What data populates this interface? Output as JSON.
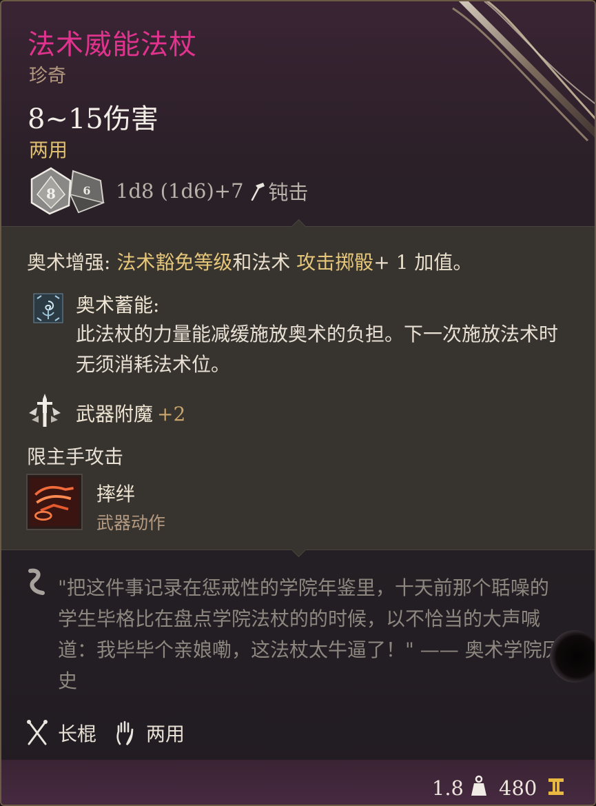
{
  "item": {
    "name": "法术威能法杖",
    "rarity": "珍奇",
    "damage": "8~15伤害",
    "handedness": "两用",
    "dice_text": "1d8 (1d6)+7",
    "damage_type": "钝击",
    "dice_faces": [
      "8",
      "6"
    ]
  },
  "boost": {
    "prefix": "奥术增强: ",
    "highlight1": "法术豁免等级",
    "mid": "和法术 ",
    "highlight2": "攻击掷骰",
    "suffix": "+ 1 加值。"
  },
  "passive": {
    "title": "奥术蓄能:",
    "description": "此法杖的力量能减缓施放奥术的负担。下一次施放法术时无须消耗法术位。"
  },
  "enchantment": {
    "label": "武器附魔",
    "value": "+2"
  },
  "restriction": "限主手攻击",
  "weapon_action": {
    "name": "摔绊",
    "type": "武器动作"
  },
  "flavor": "\"把这件事记录在惩戒性的学院年鉴里，十天前那个聒噪的学生毕格比在盘点学院法杖的的时候，以不恰当的大声喊道：我毕毕个亲娘嘞，这法杖太牛逼了！\" —— 奥术学院历史",
  "footer": {
    "proficiency": "长棍",
    "grip": "两用"
  },
  "stats": {
    "weight": "1.8",
    "price": "480"
  },
  "colors": {
    "name": "#e0338e",
    "rarity": "#b49a80",
    "handedness": "#e0c070",
    "highlight": "#e6c77a",
    "flavor": "#8e8780"
  },
  "icons": {
    "dice": "d8-d6-dice-icon",
    "damage_type": "blunt-hammer-icon",
    "passive": "arcane-swirl-icon",
    "enchantment": "sword-enchant-icon",
    "action": "topple-action-icon",
    "flavor": "quote-scroll-icon",
    "proficiency": "crossed-staff-icon",
    "grip": "hand-icon",
    "weight": "weight-icon",
    "price": "gold-coin-icon"
  }
}
